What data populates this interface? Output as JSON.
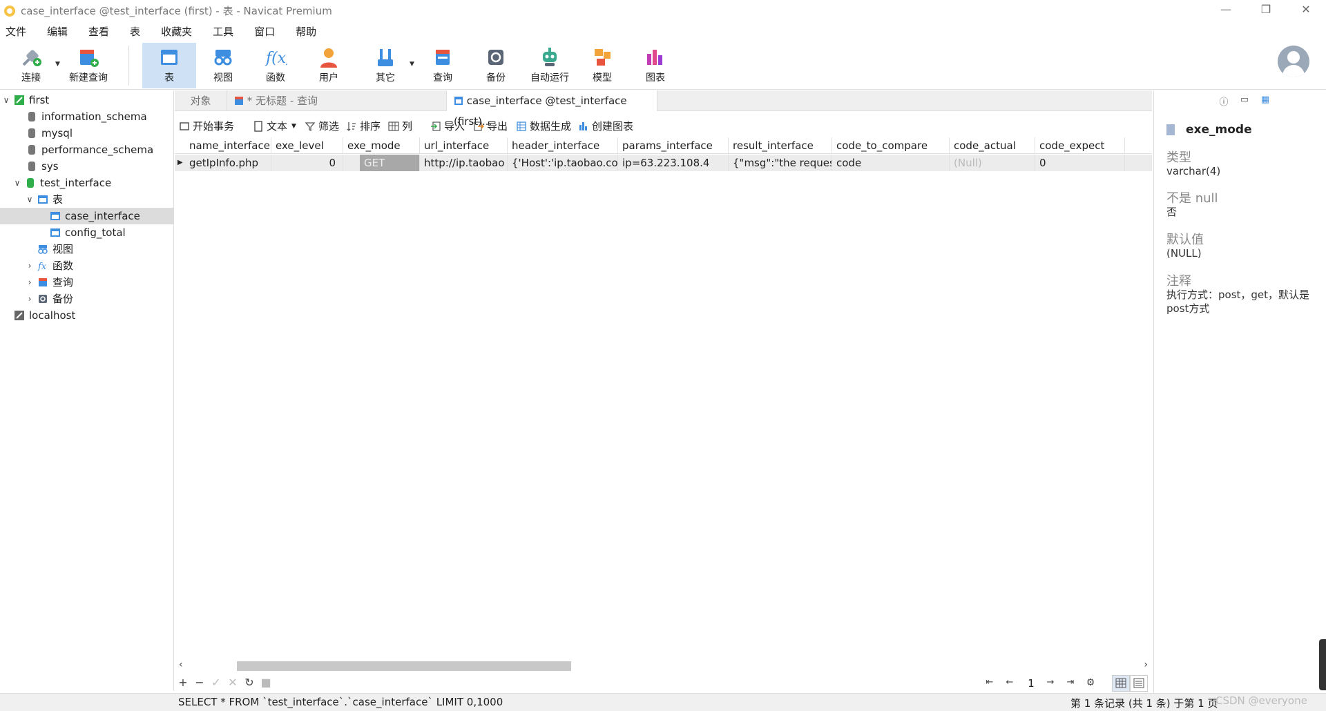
{
  "window": {
    "title": "case_interface @test_interface (first) - 表 - Navicat Premium",
    "minimize": "—",
    "restore": "❐",
    "close": "✕"
  },
  "menu": [
    "文件",
    "编辑",
    "查看",
    "表",
    "收藏夹",
    "工具",
    "窗口",
    "帮助"
  ],
  "toolbar": {
    "connect": "连接",
    "new_query": "新建查询",
    "table": "表",
    "view": "视图",
    "function": "函数",
    "user": "用户",
    "other": "其它",
    "query": "查询",
    "backup": "备份",
    "automation": "自动运行",
    "model": "模型",
    "chart": "图表"
  },
  "nav": {
    "first": "first",
    "information_schema": "information_schema",
    "mysql": "mysql",
    "performance_schema": "performance_schema",
    "sys": "sys",
    "test_interface": "test_interface",
    "tables": "表",
    "case_interface": "case_interface",
    "config_total": "config_total",
    "views": "视图",
    "functions": "函数",
    "queries": "查询",
    "backups": "备份",
    "localhost": "localhost"
  },
  "tabs": {
    "objects": "对象",
    "untitled": "* 无标题 - 查询",
    "active": "case_interface @test_interface (first)..."
  },
  "data_toolbar": {
    "begin_tx": "开始事务",
    "text": "文本",
    "filter": "筛选",
    "sort": "排序",
    "columns": "列",
    "import": "导入",
    "export": "导出",
    "data_gen": "数据生成",
    "create_chart": "创建图表"
  },
  "grid": {
    "columns": [
      "name_interface",
      "exe_level",
      "exe_mode",
      "url_interface",
      "header_interface",
      "params_interface",
      "result_interface",
      "code_to_compare",
      "code_actual",
      "code_expect"
    ],
    "row": [
      "getIpInfo.php",
      "0",
      "GET",
      "http://ip.taobao",
      "{'Host':'ip.taobao.co",
      "ip=63.223.108.4",
      "{\"msg\":\"the reques",
      "code",
      "(Null)",
      "0"
    ]
  },
  "pager": {
    "page": "1"
  },
  "status": {
    "sql": "SELECT * FROM `test_interface`.`case_interface` LIMIT 0,1000",
    "records": "第 1 条记录 (共 1 条) 于第 1 页",
    "watermark": "CSDN @everyone"
  },
  "info": {
    "field": "exe_mode",
    "type_label": "类型",
    "type_value": "varchar(4)",
    "notnull_label": "不是 null",
    "notnull_value": "否",
    "default_label": "默认值",
    "default_value": "(NULL)",
    "comment_label": "注释",
    "comment_value": "执行方式：post，get，默认是post方式"
  }
}
